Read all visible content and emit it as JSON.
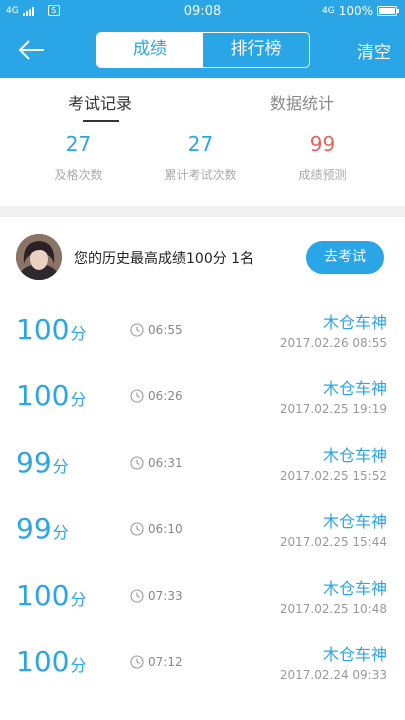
{
  "status_bar": {
    "network_left": "4G",
    "time": "09:08",
    "network_right": "4G",
    "battery": "100%"
  },
  "header": {
    "tabs": [
      {
        "label": "成绩",
        "active": true
      },
      {
        "label": "排行榜",
        "active": false
      }
    ],
    "clear_label": "清空"
  },
  "sub_tabs": [
    {
      "label": "考试记录",
      "active": true
    },
    {
      "label": "数据统计",
      "active": false
    }
  ],
  "stats": [
    {
      "value": "27",
      "label": "及格次数"
    },
    {
      "value": "27",
      "label": "累计考试次数"
    },
    {
      "value": "99",
      "label": "成绩预测"
    }
  ],
  "best": {
    "text": "您的历史最高成绩100分  1名",
    "button_label": "去考试"
  },
  "records": [
    {
      "score": "100",
      "unit": "分",
      "duration": "06:55",
      "name": "木仓车神",
      "datetime": "2017.02.26  08:55"
    },
    {
      "score": "100",
      "unit": "分",
      "duration": "06:26",
      "name": "木仓车神",
      "datetime": "2017.02.25  19:19"
    },
    {
      "score": "99",
      "unit": "分",
      "duration": "06:31",
      "name": "木仓车神",
      "datetime": "2017.02.25  15:52"
    },
    {
      "score": "99",
      "unit": "分",
      "duration": "06:10",
      "name": "木仓车神",
      "datetime": "2017.02.25  15:44"
    },
    {
      "score": "100",
      "unit": "分",
      "duration": "07:33",
      "name": "木仓车神",
      "datetime": "2017.02.25  10:48"
    },
    {
      "score": "100",
      "unit": "分",
      "duration": "07:12",
      "name": "木仓车神",
      "datetime": "2017.02.24  09:33"
    }
  ],
  "colors": {
    "accent": "#2aa6e6",
    "prediction": "#e8615f"
  }
}
